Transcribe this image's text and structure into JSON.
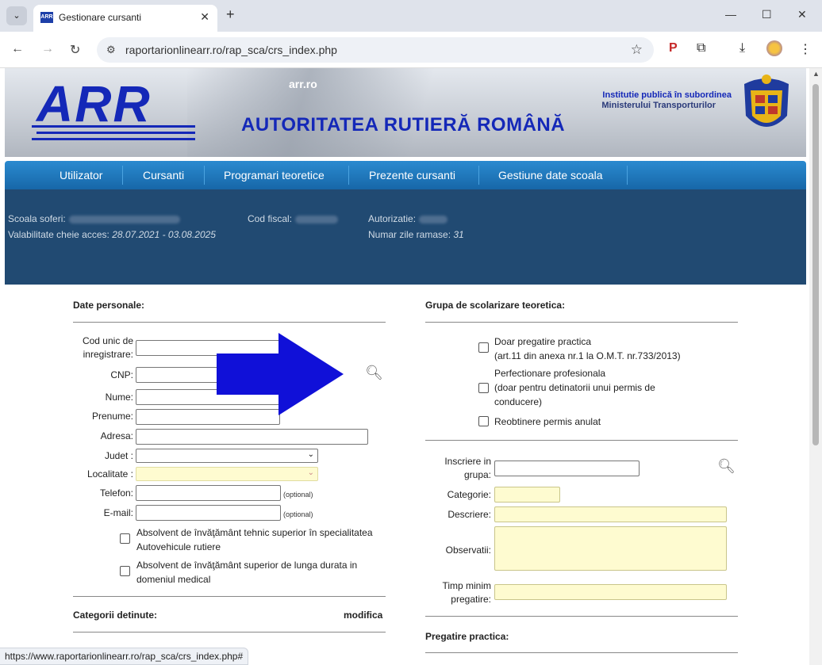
{
  "browser": {
    "tab_title": "Gestionare cursanti",
    "favicon_text": "ARR",
    "url": "raportarionlinearr.ro/rap_sca/crs_index.php",
    "status_url": "https://www.raportarionlinearr.ro/rap_sca/crs_index.php#"
  },
  "banner": {
    "logo": "ARR",
    "domain": "arr.ro",
    "institution_line1": "Institutie publică în subordinea",
    "institution_line2": "Ministerului Transporturilor",
    "title": "AUTORITATEA RUTIERĂ ROMÂNĂ"
  },
  "menu": [
    "Utilizator",
    "Cursanti",
    "Programari teoretice",
    "Prezente cursanti",
    "Gestiune date scoala"
  ],
  "info": {
    "school_label": "Scoala soferi:",
    "fiscal_label": "Cod fiscal:",
    "auth_label": "Autorizatie:",
    "validity_label": "Valabilitate cheie acces:",
    "validity_value": "28.07.2021 - 03.08.2025",
    "days_label": "Numar zile ramase:",
    "days_value": "31"
  },
  "personal": {
    "title": "Date personale:",
    "code_label_1": "Cod unic de",
    "code_label_2": "inregistrare:",
    "cnp_label": "CNP:",
    "name_label": "Nume:",
    "firstname_label": "Prenume:",
    "address_label": "Adresa:",
    "county_label": "Judet :",
    "locality_label": "Localitate :",
    "phone_label": "Telefon:",
    "email_label": "E-mail:",
    "optional": "(optional)",
    "grad1_line1": "Absolvent de învăţământ tehnic superior în specialitatea",
    "grad1_line2": "Autovehicule rutiere",
    "grad2_line1": "Absolvent de învăţământ superior de lunga durata in",
    "grad2_line2": "domeniul medical",
    "categories_title": "Categorii detinute:",
    "modify": "modifica"
  },
  "group": {
    "title": "Grupa de scolarizare teoretica:",
    "opt1_line1": "Doar pregatire practica",
    "opt1_line2": "(art.11 din anexa nr.1 la O.M.T. nr.733/2013)",
    "opt2_line1": "Perfectionare profesionala",
    "opt2_line2": "(doar pentru detinatorii unui permis de",
    "opt2_line3": "conducere)",
    "opt3": "Reobtinere permis anulat",
    "enroll_line1": "Inscriere in",
    "enroll_line2": "grupa:",
    "category_label": "Categorie:",
    "description_label": "Descriere:",
    "observations_label": "Observatii:",
    "min_time_line1": "Timp minim",
    "min_time_line2": "pregatire:",
    "practical_title": "Pregatire practica:"
  },
  "colors": {
    "brand_blue": "#1428b8",
    "menu_blue": "#1767a8",
    "info_bg": "#214a72",
    "highlight_yellow": "#fefbd0",
    "arrow_blue": "#1010d8"
  }
}
